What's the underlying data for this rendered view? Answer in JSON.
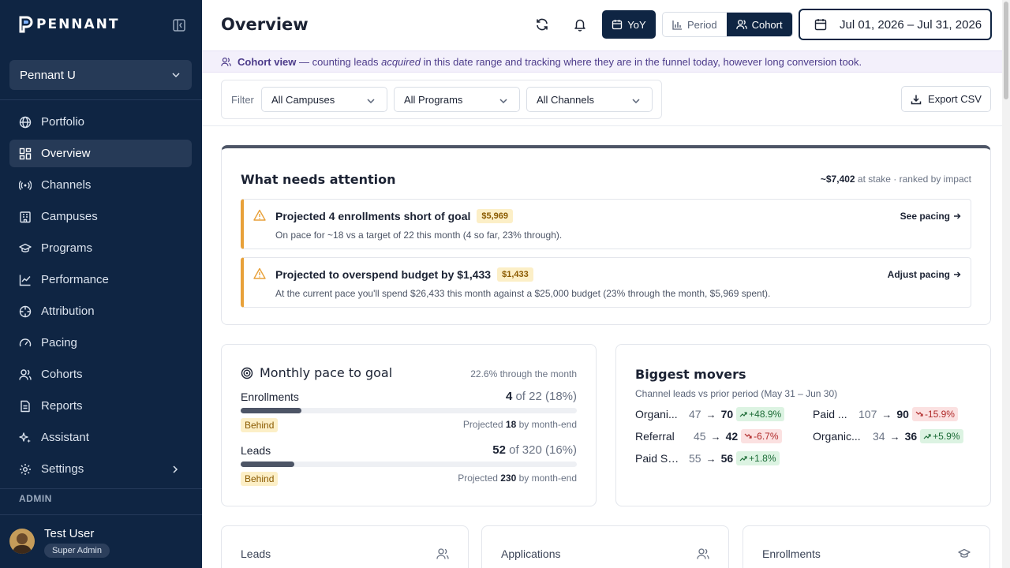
{
  "app": {
    "name": "PENNANT"
  },
  "sidebar": {
    "org": "Pennant U",
    "items": [
      {
        "label": "Portfolio",
        "icon": "globe-icon"
      },
      {
        "label": "Overview",
        "icon": "dashboard-icon",
        "active": true
      },
      {
        "label": "Channels",
        "icon": "broadcast-icon"
      },
      {
        "label": "Campuses",
        "icon": "building-icon"
      },
      {
        "label": "Programs",
        "icon": "graduation-cap-icon"
      },
      {
        "label": "Performance",
        "icon": "line-chart-icon"
      },
      {
        "label": "Attribution",
        "icon": "crosshair-icon"
      },
      {
        "label": "Pacing",
        "icon": "gauge-icon"
      },
      {
        "label": "Cohorts",
        "icon": "users-icon"
      },
      {
        "label": "Reports",
        "icon": "file-icon"
      },
      {
        "label": "Assistant",
        "icon": "sparkles-icon"
      },
      {
        "label": "Settings",
        "icon": "gear-icon"
      }
    ],
    "admin_label": "ADMIN",
    "user": {
      "name": "Test User",
      "role": "Super Admin"
    }
  },
  "header": {
    "title": "Overview",
    "yoy_label": "YoY",
    "period_label": "Period",
    "cohort_label": "Cohort",
    "date_range": "Jul 01, 2026 – Jul 31, 2026"
  },
  "banner": {
    "strong": "Cohort view",
    "text_before": " — counting leads ",
    "em": "acquired",
    "text_after": " in this date range and tracking where they are in the funnel today, however long conversion took."
  },
  "filters": {
    "label": "Filter",
    "campus": "All Campuses",
    "program": "All Programs",
    "channel": "All Channels",
    "export_label": "Export CSV"
  },
  "attention": {
    "title": "What needs attention",
    "at_stake_amount": "~$7,402",
    "at_stake_text": " at stake · ranked by impact",
    "alerts": [
      {
        "title": "Projected 4 enrollments short of goal",
        "badge": "$5,969",
        "sub": "On pace for ~18 vs a target of 22 this month (4 so far, 23% through).",
        "link": "See pacing"
      },
      {
        "title": "Projected to overspend budget by $1,433",
        "badge": "$1,433",
        "sub": "At the current pace you'll spend $26,433 this month against a $25,000 budget (23% through the month, $5,969 spent).",
        "link": "Adjust pacing"
      }
    ]
  },
  "pace": {
    "title": "Monthly pace to goal",
    "note": "22.6% through the month",
    "metrics": [
      {
        "name": "Enrollments",
        "value": "4",
        "of_text": " of 22 (18%)",
        "progress": 0.18,
        "status": "Behind",
        "projected_prefix": "Projected ",
        "projected_value": "18",
        "projected_suffix": " by month-end"
      },
      {
        "name": "Leads",
        "value": "52",
        "of_text": " of 320 (16%)",
        "progress": 0.16,
        "status": "Behind",
        "projected_prefix": "Projected ",
        "projected_value": "230",
        "projected_suffix": " by month-end"
      }
    ]
  },
  "movers": {
    "title": "Biggest movers",
    "subtitle": "Channel leads vs prior period (May 31 – Jun 30)",
    "items": [
      {
        "name": "Organi...",
        "prev": "47",
        "cur": "70",
        "change": "+48.9%",
        "dir": "up"
      },
      {
        "name": "Paid ...",
        "prev": "107",
        "cur": "90",
        "change": "-15.9%",
        "dir": "down"
      },
      {
        "name": "Referral",
        "prev": "45",
        "cur": "42",
        "change": "-6.7%",
        "dir": "down"
      },
      {
        "name": "Organic...",
        "prev": "34",
        "cur": "36",
        "change": "+5.9%",
        "dir": "up"
      },
      {
        "name": "Paid So...",
        "prev": "55",
        "cur": "56",
        "change": "+1.8%",
        "dir": "up"
      }
    ]
  },
  "kpis": [
    {
      "label": "Leads",
      "icon": "users-icon"
    },
    {
      "label": "Applications",
      "icon": "users-icon"
    },
    {
      "label": "Enrollments",
      "icon": "graduation-cap-icon"
    }
  ],
  "colors": {
    "sidebar_bg": "#0f2543",
    "accent_dark": "#0f2543",
    "warning": "#e8a13a",
    "positive": "#1c6b36",
    "negative": "#b02a2a"
  }
}
